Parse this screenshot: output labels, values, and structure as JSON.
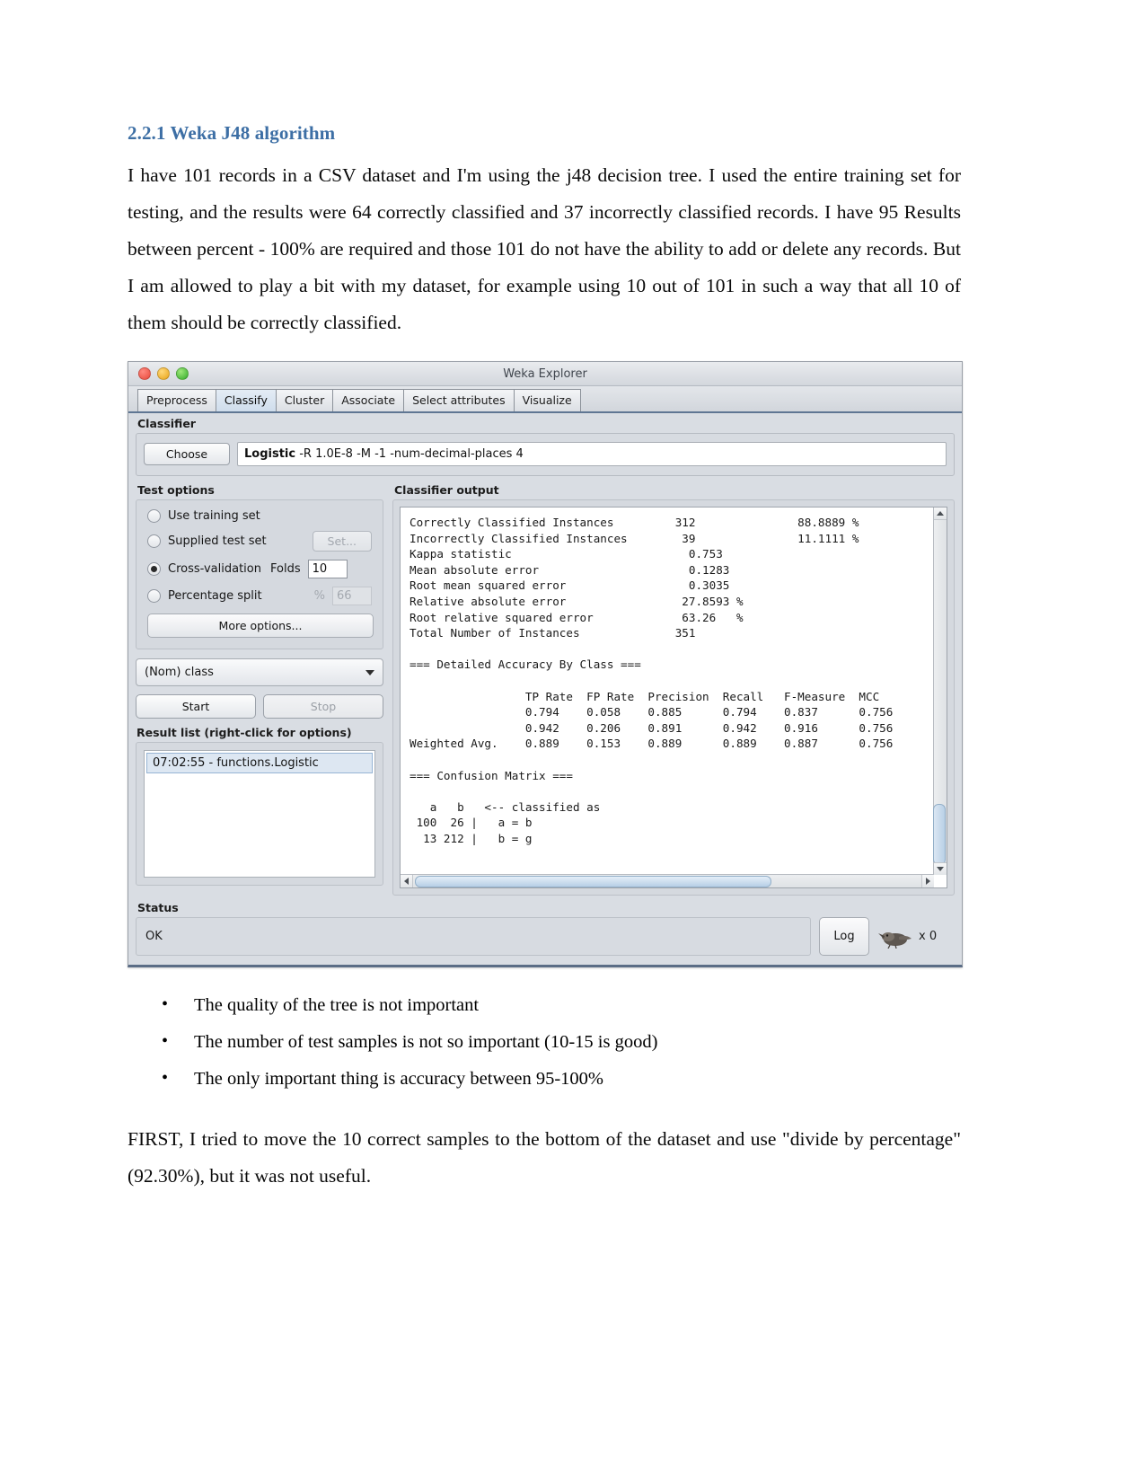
{
  "document": {
    "heading": "2.2.1 Weka J48 algorithm",
    "paragraph1": "I have 101 records in a CSV dataset and I'm using the j48 decision tree. I used the entire training set for testing, and the results were 64 correctly classified and 37 incorrectly classified records. I have 95 Results between percent - 100% are required and those 101 do not have the ability to add or delete any records. But I am allowed to play a bit with my dataset, for example using 10 out of 101 in such a way that all 10 of them should be correctly classified.",
    "bullets": [
      "The quality of the tree is not important",
      "The number of test samples is not so important (10-15 is good)",
      "The only important thing is accuracy between 95-100%"
    ],
    "paragraph2": "FIRST, I tried to move the 10 correct samples to the bottom of the dataset and use \"divide by percentage\" (92.30%), but it was not useful."
  },
  "weka": {
    "window_title": "Weka Explorer",
    "traffic_lights": [
      "close-red",
      "minimize-yellow",
      "zoom-green"
    ],
    "tabs": [
      {
        "label": "Preprocess",
        "active": false
      },
      {
        "label": "Classify",
        "active": true
      },
      {
        "label": "Cluster",
        "active": false
      },
      {
        "label": "Associate",
        "active": false
      },
      {
        "label": "Select attributes",
        "active": false
      },
      {
        "label": "Visualize",
        "active": false
      }
    ],
    "classifier": {
      "section_label": "Classifier",
      "choose_label": "Choose",
      "scheme_name": "Logistic",
      "scheme_options": "-R 1.0E-8 -M -1 -num-decimal-places 4"
    },
    "test_options": {
      "label": "Test options",
      "options": [
        {
          "label": "Use training set",
          "selected": false
        },
        {
          "label": "Supplied test set",
          "selected": false
        },
        {
          "label": "Cross-validation",
          "selected": true
        },
        {
          "label": "Percentage split",
          "selected": false
        }
      ],
      "set_button": "Set...",
      "folds_label": "Folds",
      "folds_value": "10",
      "percent_sign": "%",
      "percent_value": "66",
      "more_options": "More options..."
    },
    "class_combo": {
      "value": "(Nom) class"
    },
    "start_button": "Start",
    "stop_button": "Stop",
    "result_list": {
      "label": "Result list (right-click for options)",
      "items": [
        "07:02:55 - functions.Logistic"
      ]
    },
    "classifier_output": {
      "label": "Classifier output",
      "text": "Correctly Classified Instances         312               88.8889 %\nIncorrectly Classified Instances        39               11.1111 %\nKappa statistic                          0.753\nMean absolute error                      0.1283\nRoot mean squared error                  0.3035\nRelative absolute error                 27.8593 %\nRoot relative squared error             63.26   %\nTotal Number of Instances              351\n\n=== Detailed Accuracy By Class ===\n\n                 TP Rate  FP Rate  Precision  Recall   F-Measure  MCC\n                 0.794    0.058    0.885      0.794    0.837      0.756\n                 0.942    0.206    0.891      0.942    0.916      0.756\nWeighted Avg.    0.889    0.153    0.889      0.889    0.887      0.756\n\n=== Confusion Matrix ===\n\n   a   b   <-- classified as\n 100  26 |   a = b\n  13 212 |   b = g"
    },
    "status": {
      "label": "Status",
      "value": "OK",
      "log_button": "Log",
      "bird_counter": "x 0"
    }
  },
  "chart_data": {
    "type": "table",
    "title": "Weka Logistic classifier evaluation (10-fold cross-validation)",
    "summary": {
      "Correctly Classified Instances": {
        "count": 312,
        "percent": 88.8889
      },
      "Incorrectly Classified Instances": {
        "count": 39,
        "percent": 11.1111
      },
      "Kappa statistic": 0.753,
      "Mean absolute error": 0.1283,
      "Root mean squared error": 0.3035,
      "Relative absolute error": 27.8593,
      "Root relative squared error": 63.26,
      "Total Number of Instances": 351
    },
    "columns": [
      "TP Rate",
      "FP Rate",
      "Precision",
      "Recall",
      "F-Measure",
      "MCC"
    ],
    "rows": [
      {
        "label": "",
        "values": [
          0.794,
          0.058,
          0.885,
          0.794,
          0.837,
          0.756
        ]
      },
      {
        "label": "",
        "values": [
          0.942,
          0.206,
          0.891,
          0.942,
          0.916,
          0.756
        ]
      },
      {
        "label": "Weighted Avg.",
        "values": [
          0.889,
          0.153,
          0.889,
          0.889,
          0.887,
          0.756
        ]
      }
    ],
    "confusion_matrix": {
      "headers": [
        "a",
        "b"
      ],
      "rows": [
        {
          "counts": [
            100,
            26
          ],
          "class": "a = b"
        },
        {
          "counts": [
            13,
            212
          ],
          "class": "b = g"
        }
      ]
    }
  }
}
